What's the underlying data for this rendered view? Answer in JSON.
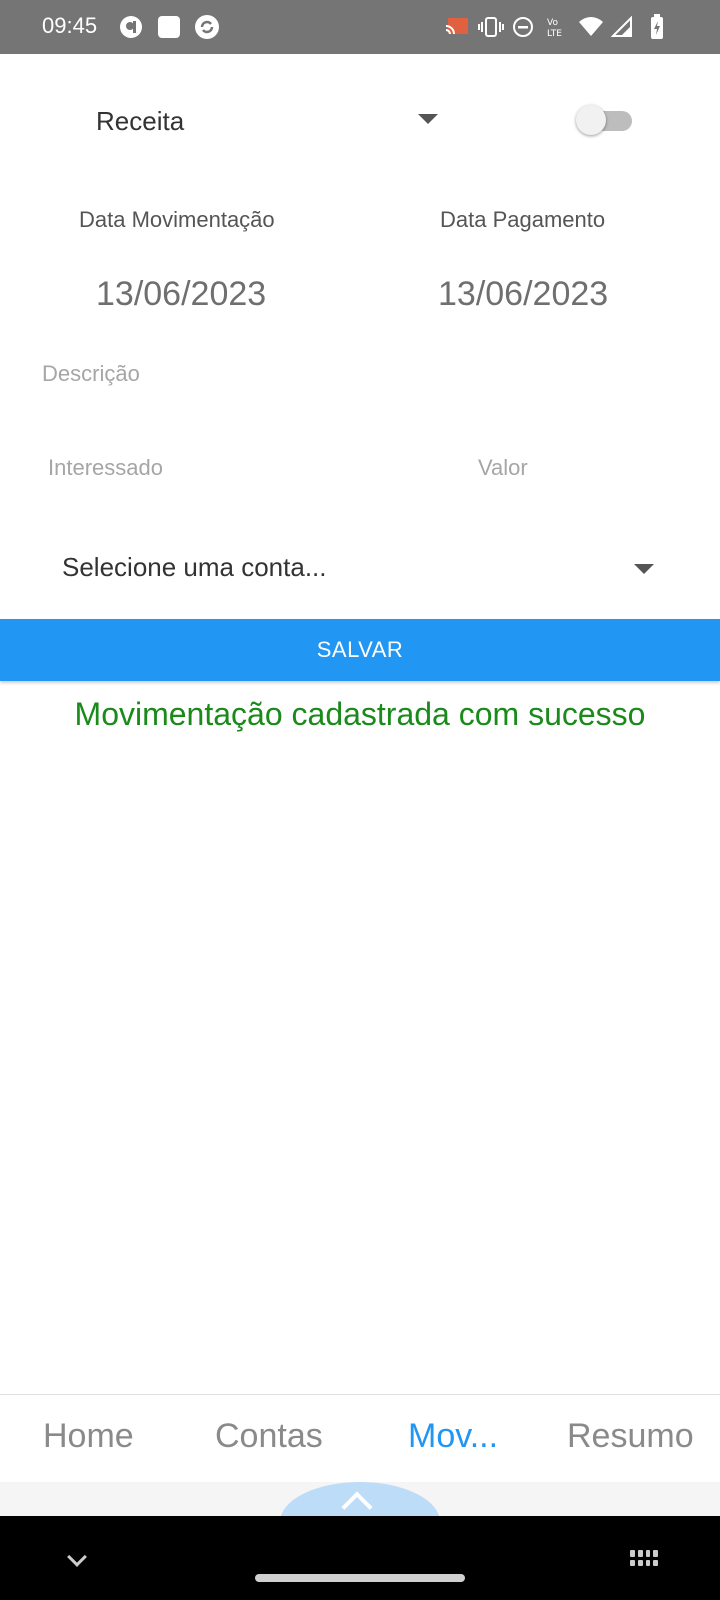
{
  "status_bar": {
    "time": "09:45",
    "left_icons": [
      "app-circle-icon",
      "app-square-icon",
      "sync-icon"
    ],
    "right_icons": [
      "cast-icon",
      "vibrate-icon",
      "do-not-disturb-icon",
      "volte-icon",
      "wifi-icon",
      "signal-icon",
      "battery-icon"
    ]
  },
  "form": {
    "tipo": {
      "selected": "Receita",
      "toggle_on": false
    },
    "data_movimentacao": {
      "label": "Data Movimentação",
      "value": "13/06/2023"
    },
    "data_pagamento": {
      "label": "Data Pagamento",
      "value": "13/06/2023"
    },
    "descricao": {
      "placeholder": "Descrição",
      "value": ""
    },
    "interessado": {
      "placeholder": "Interessado",
      "value": ""
    },
    "valor": {
      "placeholder": "Valor",
      "value": ""
    },
    "conta": {
      "selected": "Selecione uma conta..."
    },
    "save_label": "SALVAR",
    "success_message": "Movimentação cadastrada com sucesso"
  },
  "tabs": [
    {
      "label": "Home",
      "active": false
    },
    {
      "label": "Contas",
      "active": false
    },
    {
      "label": "Mov...",
      "active": true
    },
    {
      "label": "Resumo",
      "active": false
    }
  ],
  "colors": {
    "accent": "#2196f3",
    "success": "#1a8a1a",
    "status_bar": "#757575"
  }
}
